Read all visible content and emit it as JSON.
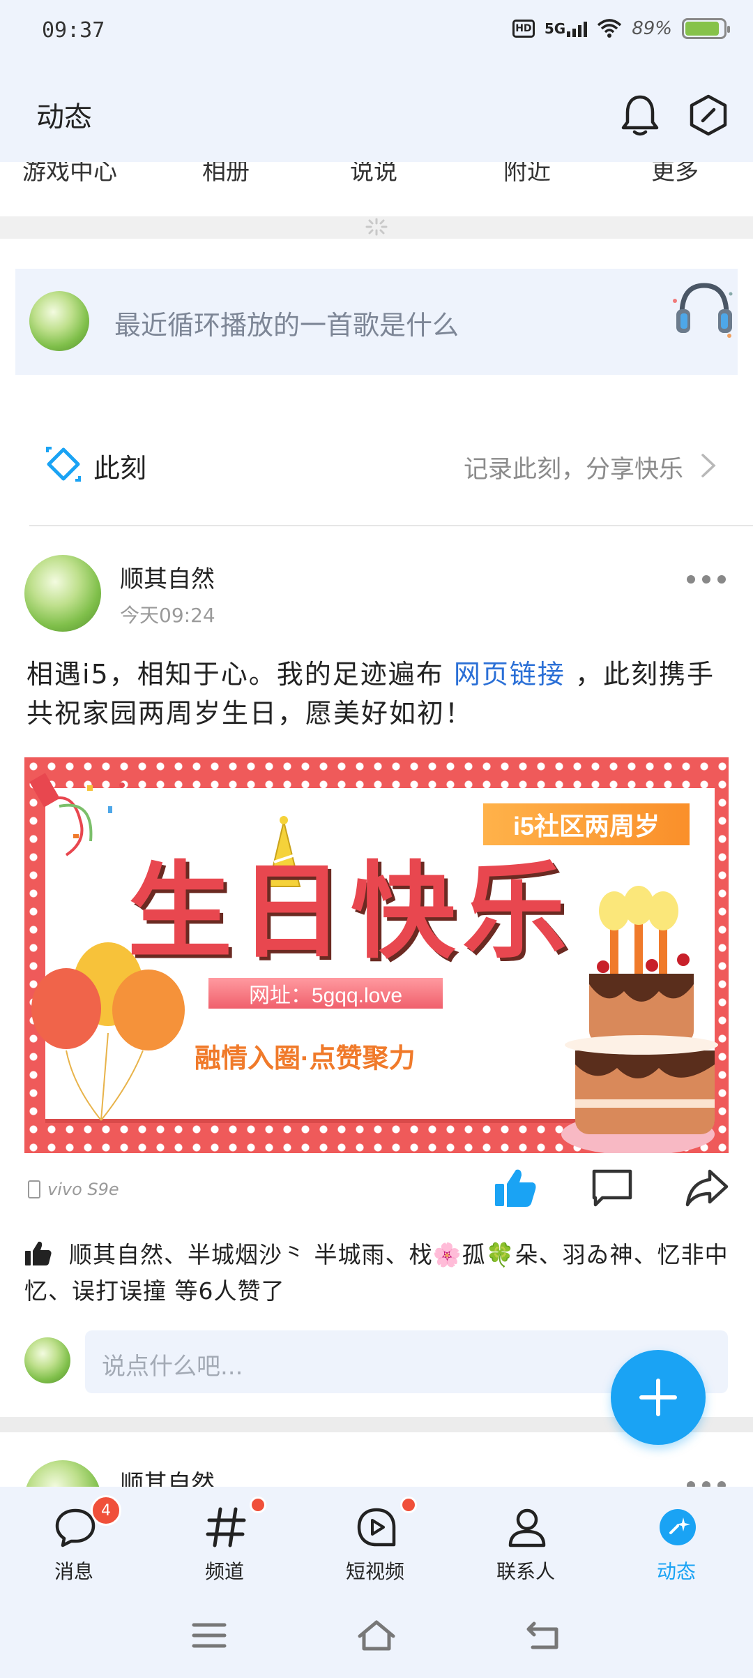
{
  "status_bar": {
    "time": "09:37",
    "hd": "HD",
    "network": "5G",
    "battery_percent": "89%",
    "battery_level": 0.89
  },
  "header": {
    "title": "动态",
    "icons": [
      "bell-icon",
      "hexagon-icon"
    ]
  },
  "shortcuts": [
    "游戏中心",
    "相册",
    "说说",
    "附近",
    "更多"
  ],
  "prompt": {
    "text": "最近循环播放的一首歌是什么"
  },
  "moment": {
    "label": "此刻",
    "hint": "记录此刻，分享快乐"
  },
  "post": {
    "author": "顺其自然",
    "time": "今天09:24",
    "text_before": "相遇i5，相知于心。我的足迹遍布",
    "link": "网页链接",
    "text_after": "，此刻携手共祝家园两周岁生日，愿美好如初！",
    "banner": {
      "tag": "i5社区两周岁",
      "title": "生日快乐",
      "url": "网址：5gqq.love",
      "slogan": "融情入圈·点赞聚力"
    },
    "device": "vivo S9e",
    "likes_text": "顺其自然、半城烟沙⺀ 半城雨、𣏾🌸孤🍀朵、羽ゐ神、忆非中忆、误打误撞 等6人赞了",
    "comment_placeholder": "说点什么吧..."
  },
  "post2": {
    "author": "顺其自然"
  },
  "bottom_nav": [
    {
      "label": "消息",
      "icon": "message-icon",
      "badge": "4"
    },
    {
      "label": "频道",
      "icon": "channel-hash-icon",
      "dot": true
    },
    {
      "label": "短视频",
      "icon": "short-video-icon",
      "dot": true
    },
    {
      "label": "联系人",
      "icon": "contacts-icon"
    },
    {
      "label": "动态",
      "icon": "moments-icon",
      "active": true
    }
  ],
  "colors": {
    "accent": "#1aa3f4",
    "header_bg": "#eef3fc",
    "badge": "#f0503a",
    "link": "#2a6fd6"
  }
}
